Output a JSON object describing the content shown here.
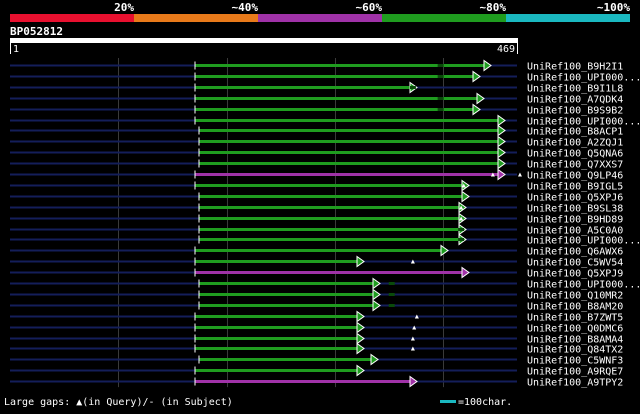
{
  "legend": {
    "segments": [
      {
        "label": "20%",
        "color": "#e8102f"
      },
      {
        "label": "~40%",
        "color": "#e87a1a"
      },
      {
        "label": "~60%",
        "color": "#a032a8"
      },
      {
        "label": "~80%",
        "color": "#1f9c1f"
      },
      {
        "label": "~100%",
        "color": "#1ab8c0"
      }
    ]
  },
  "query": {
    "name": "BP052812",
    "start_label": "1",
    "end_label": "469",
    "length": 469
  },
  "colors": {
    "green": "#1f9c1f",
    "purple": "#a032a8",
    "navy": "#141e5a",
    "grid": "#3a3a3a",
    "cyan": "#1ab8c0",
    "white": "#ffffff"
  },
  "hits": [
    {
      "name": "UniRef100_B9H2I1",
      "color": "green",
      "start": 1,
      "end": 419,
      "query_gaps": [],
      "subject_gaps": [
        296
      ]
    },
    {
      "name": "UniRef100_UPI000...",
      "color": "green",
      "start": 1,
      "end": 409,
      "query_gaps": [],
      "subject_gaps": [
        296
      ]
    },
    {
      "name": "UniRef100_B9I1L8",
      "color": "green",
      "start": 1,
      "end": 356,
      "query_gaps": [],
      "subject_gaps": [
        254
      ]
    },
    {
      "name": "UniRef100_A7QDK4",
      "color": "green",
      "start": 1,
      "end": 413,
      "query_gaps": [],
      "subject_gaps": [
        296
      ]
    },
    {
      "name": "UniRef100_B9S9B2",
      "color": "green",
      "start": 1,
      "end": 409,
      "query_gaps": [],
      "subject_gaps": [
        296
      ]
    },
    {
      "name": "UniRef100_UPI000...",
      "color": "green",
      "start": 1,
      "end": 439,
      "query_gaps": [],
      "subject_gaps": []
    },
    {
      "name": "UniRef100_B8ACP1",
      "color": "green",
      "start": 3,
      "end": 439,
      "query_gaps": [],
      "subject_gaps": []
    },
    {
      "name": "UniRef100_A2ZQJ1",
      "color": "green",
      "start": 3,
      "end": 439,
      "query_gaps": [],
      "subject_gaps": []
    },
    {
      "name": "UniRef100_Q5QNA6",
      "color": "green",
      "start": 3,
      "end": 439,
      "query_gaps": [],
      "subject_gaps": []
    },
    {
      "name": "UniRef100_Q7XXS7",
      "color": "green",
      "start": 3,
      "end": 439,
      "query_gaps": [],
      "subject_gaps": []
    },
    {
      "name": "UniRef100_Q9LP46",
      "color": "purple",
      "start": 1,
      "end": 443,
      "query_gaps": [
        375,
        416
      ],
      "subject_gaps": []
    },
    {
      "name": "UniRef100_B9IGL5",
      "color": "green",
      "start": 1,
      "end": 400,
      "query_gaps": [
        331
      ],
      "subject_gaps": []
    },
    {
      "name": "UniRef100_Q5XPJ6",
      "color": "green",
      "start": 5,
      "end": 400,
      "query_gaps": [],
      "subject_gaps": []
    },
    {
      "name": "UniRef100_B9SL38",
      "color": "green",
      "start": 3,
      "end": 397,
      "query_gaps": [
        327
      ],
      "subject_gaps": []
    },
    {
      "name": "UniRef100_B9HD89",
      "color": "green",
      "start": 3,
      "end": 397,
      "query_gaps": [
        327
      ],
      "subject_gaps": []
    },
    {
      "name": "UniRef100_A5C0A0",
      "color": "green",
      "start": 3,
      "end": 397,
      "query_gaps": [],
      "subject_gaps": [
        327
      ]
    },
    {
      "name": "UniRef100_UPI000...",
      "color": "green",
      "start": 3,
      "end": 397,
      "query_gaps": [],
      "subject_gaps": [
        327
      ]
    },
    {
      "name": "UniRef100_Q6AWX6",
      "color": "green",
      "start": 1,
      "end": 382,
      "query_gaps": [],
      "subject_gaps": []
    },
    {
      "name": "UniRef100_C5WV54",
      "color": "green",
      "start": 1,
      "end": 310,
      "query_gaps": [
        254
      ],
      "subject_gaps": []
    },
    {
      "name": "UniRef100_Q5XPJ9",
      "color": "purple",
      "start": 1,
      "end": 400,
      "query_gaps": [],
      "subject_gaps": []
    },
    {
      "name": "UniRef100_UPI000...",
      "color": "green",
      "start": 5,
      "end": 324,
      "query_gaps": [],
      "subject_gaps": [
        222
      ]
    },
    {
      "name": "UniRef100_Q10MR2",
      "color": "green",
      "start": 5,
      "end": 324,
      "query_gaps": [],
      "subject_gaps": [
        222
      ]
    },
    {
      "name": "UniRef100_B8AM20",
      "color": "green",
      "start": 5,
      "end": 324,
      "query_gaps": [],
      "subject_gaps": [
        222
      ]
    },
    {
      "name": "UniRef100_B7ZWT5",
      "color": "green",
      "start": 1,
      "end": 310,
      "query_gaps": [
        260
      ],
      "subject_gaps": []
    },
    {
      "name": "UniRef100_Q0DMC6",
      "color": "green",
      "start": 1,
      "end": 310,
      "query_gaps": [
        256
      ],
      "subject_gaps": []
    },
    {
      "name": "UniRef100_B8AMA4",
      "color": "green",
      "start": 1,
      "end": 310,
      "query_gaps": [
        254
      ],
      "subject_gaps": []
    },
    {
      "name": "UniRef100_Q84TX2",
      "color": "green",
      "start": 1,
      "end": 310,
      "query_gaps": [
        254
      ],
      "subject_gaps": []
    },
    {
      "name": "UniRef100_C5WNF3",
      "color": "green",
      "start": 5,
      "end": 322,
      "query_gaps": [],
      "subject_gaps": []
    },
    {
      "name": "UniRef100_A9RQE7",
      "color": "green",
      "start": 1,
      "end": 310,
      "query_gaps": [],
      "subject_gaps": []
    },
    {
      "name": "UniRef100_A9TPY2",
      "color": "purple",
      "start": 1,
      "end": 356,
      "query_gaps": [],
      "subject_gaps": []
    }
  ],
  "footer": {
    "gaps_text": "Large gaps: ▲(in Query)/- (in Subject)",
    "scale_text": "=100char."
  }
}
